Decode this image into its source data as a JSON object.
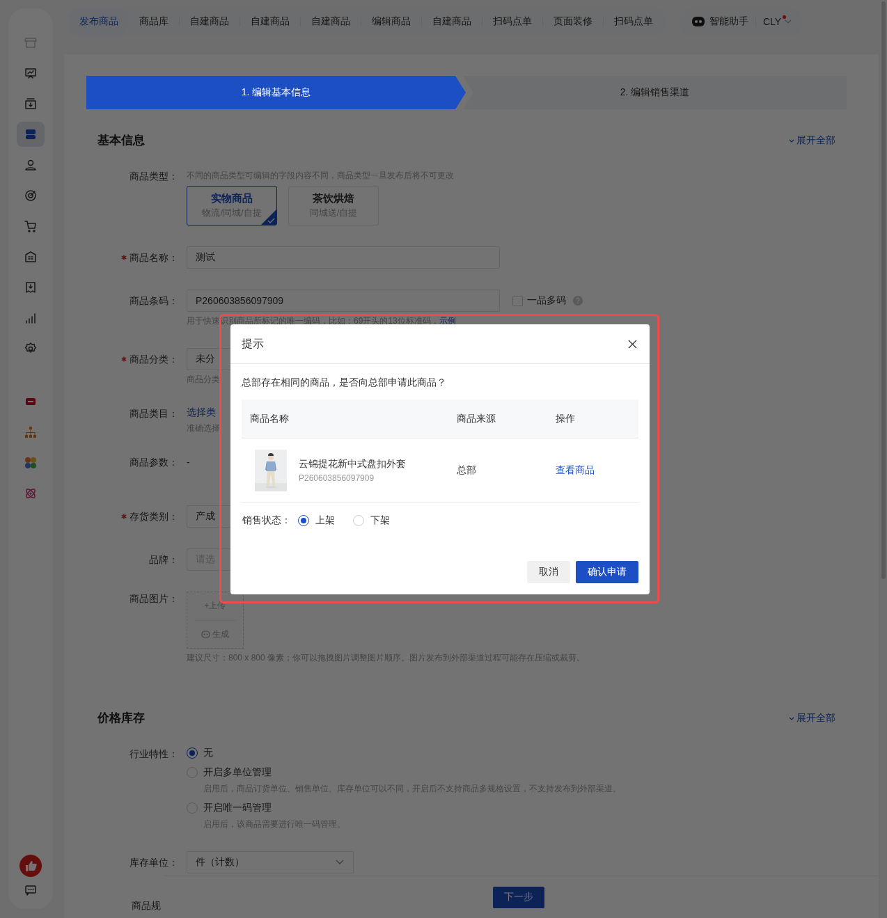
{
  "sidebar": {
    "items": [
      {
        "selected": false
      },
      {
        "selected": false
      },
      {
        "selected": false
      },
      {
        "selected": true
      },
      {
        "selected": false
      },
      {
        "selected": false
      },
      {
        "selected": false
      },
      {
        "selected": false
      },
      {
        "selected": false
      },
      {
        "selected": false
      },
      {
        "selected": false
      },
      {
        "selected": false
      },
      {
        "selected": false
      },
      {
        "selected": false
      },
      {
        "selected": false
      }
    ]
  },
  "topbar": {
    "tabs": [
      {
        "label": "发布商品",
        "selected": true
      },
      {
        "label": "商品库",
        "selected": false
      },
      {
        "label": "自建商品",
        "selected": false
      },
      {
        "label": "自建商品",
        "selected": false
      },
      {
        "label": "自建商品",
        "selected": false
      },
      {
        "label": "编辑商品",
        "selected": false
      },
      {
        "label": "自建商品",
        "selected": false
      },
      {
        "label": "扫码点单",
        "selected": false
      },
      {
        "label": "页面装修",
        "selected": false
      },
      {
        "label": "扫码点单",
        "selected": false
      }
    ],
    "assistant": "智能助手",
    "user": {
      "name": "CLY",
      "notification_dot": true
    }
  },
  "steps": [
    {
      "label": "1. 编辑基本信息",
      "selected": true
    },
    {
      "label": "2. 编辑销售渠道",
      "selected": false
    }
  ],
  "sections": [
    {
      "title": "基本信息",
      "expand_link": "展开全部",
      "fields": [
        {
          "kind": "type_cards",
          "label": "商品类型：",
          "required": false,
          "hint": "不同的商品类型可编辑的字段内容不同，商品类型一旦发布后将不可更改",
          "options": [
            {
              "title": "实物商品",
              "subtitle": "物流/同城/自提",
              "selected": true
            },
            {
              "title": "茶饮烘焙",
              "subtitle": "同城送/自提",
              "selected": false
            }
          ]
        },
        {
          "kind": "input",
          "label": "商品名称：",
          "required": true,
          "value": "测试"
        },
        {
          "kind": "input",
          "label": "商品条码：",
          "required": false,
          "value": "P260603856097909",
          "checkbox": {
            "label": "一品多码",
            "checked": false
          },
          "note": "用于快速识别商品所标记的唯一编码，比如：69开头的13位标准码，",
          "note_link": "示例"
        },
        {
          "kind": "partial_select",
          "label": "商品分类：",
          "required": true,
          "value": "未分",
          "note": "商品分类"
        },
        {
          "kind": "link",
          "label": "商品类目：",
          "required": false,
          "value": "选择类",
          "note": "准确选择"
        },
        {
          "kind": "text",
          "label": "商品参数：",
          "required": false,
          "value": "-"
        },
        {
          "kind": "partial_select",
          "label": "存货类别：",
          "required": true,
          "value": "产成"
        },
        {
          "kind": "partial_select",
          "label": "品牌：",
          "required": false,
          "placeholder": "请选"
        },
        {
          "kind": "upload",
          "label": "商品图片：",
          "required": false,
          "upload": "+上传",
          "generate": "生成",
          "note": "建议尺寸：800 x 800 像素；你可以拖拽图片调整图片顺序。图片发布到外部渠道过程可能存在压缩或裁剪。"
        }
      ]
    },
    {
      "title": "价格库存",
      "expand_link": "展开全部",
      "fields": [
        {
          "kind": "radio_group",
          "label": "行业特性：",
          "required": false,
          "options": [
            {
              "label": "无",
              "selected": true
            },
            {
              "label": "开启多单位管理",
              "selected": false,
              "note": "启用后，商品订货单位、销售单位、库存单位可以不同，开启后不支持商品多规格设置，不支持发布到外部渠道。"
            },
            {
              "label": "开启唯一码管理",
              "selected": false,
              "note": "启用后，该商品需要进行唯一码管理。"
            }
          ]
        },
        {
          "kind": "select",
          "label": "库存单位：",
          "required": false,
          "value": "件（计数）"
        },
        {
          "kind": "cut_label",
          "label": "商品规",
          "required": false
        }
      ]
    }
  ],
  "footer": {
    "next_button": "下一步"
  },
  "modal": {
    "title": "提示",
    "message": "总部存在相同的商品，是否向总部申请此商品？",
    "table": {
      "columns": [
        "商品名称",
        "商品来源",
        "操作"
      ],
      "rows": [
        {
          "name": "云锦提花新中式盘扣外套",
          "code": "P260603856097909",
          "source": "总部",
          "action": "查看商品"
        }
      ]
    },
    "sale_status": {
      "label": "销售状态：",
      "options": [
        {
          "label": "上架",
          "selected": true
        },
        {
          "label": "下架",
          "selected": false
        }
      ]
    },
    "buttons": [
      {
        "label": "取消",
        "kind": "secondary"
      },
      {
        "label": "确认申请",
        "kind": "primary"
      }
    ]
  }
}
